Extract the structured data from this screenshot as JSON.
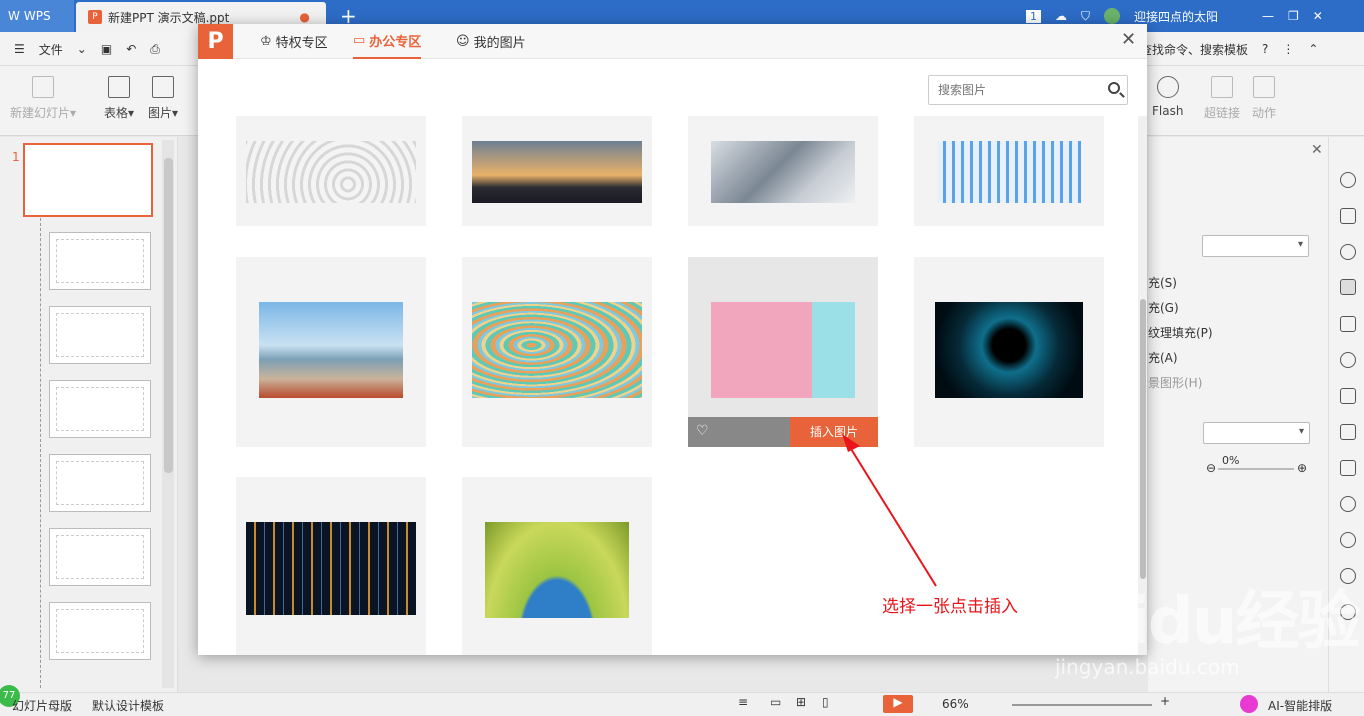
{
  "titlebar": {
    "app": "WPS",
    "doc_tab": "新建PPT 演示文稿.ppt",
    "page_badge": "1",
    "user": "迎接四点的太阳"
  },
  "menubar": {
    "file": "文件",
    "search_label": "查找命令、搜索模板"
  },
  "ribbon": {
    "new_slide": "新建幻灯片",
    "table": "表格",
    "picture": "图片",
    "flash": "Flash",
    "hyperlink": "超链接",
    "action": "动作"
  },
  "left_panel": {
    "current_slide_number": "1"
  },
  "right_pane": {
    "fill_s": "充(S)",
    "fill_g": "充(G)",
    "texture": "纹理填充(P)",
    "fill_a": "充(A)",
    "pattern": "景图形(H)",
    "transparency": "0%"
  },
  "statusbar": {
    "master": "幻灯片母版",
    "template": "默认设计模板",
    "zoom": "66%",
    "ai": "AI-智能排版",
    "badge": "77"
  },
  "dialog": {
    "tabs": [
      {
        "label": "特权专区"
      },
      {
        "label": "办公专区"
      },
      {
        "label": "我的图片"
      }
    ],
    "active_tab": "办公专区",
    "search_placeholder": "搜索图片",
    "insert_label": "插入图片",
    "cards": [
      {
        "name": "maze"
      },
      {
        "name": "mountain-people"
      },
      {
        "name": "office-meeting"
      },
      {
        "name": "bar-chart-doc"
      },
      {
        "name": "car-beach"
      },
      {
        "name": "wavy-pattern"
      },
      {
        "name": "ice-pops"
      },
      {
        "name": "blue-vortex"
      },
      {
        "name": "circuit-lights"
      },
      {
        "name": "globe-figures"
      }
    ]
  },
  "annotation": "选择一张点击插入",
  "watermark": {
    "brand": "Baidu经验",
    "url": "jingyan.baidu.com"
  },
  "colors": {
    "accent": "#e8633a",
    "titlebar": "#2d6dc8",
    "annotation": "#e8151a"
  }
}
